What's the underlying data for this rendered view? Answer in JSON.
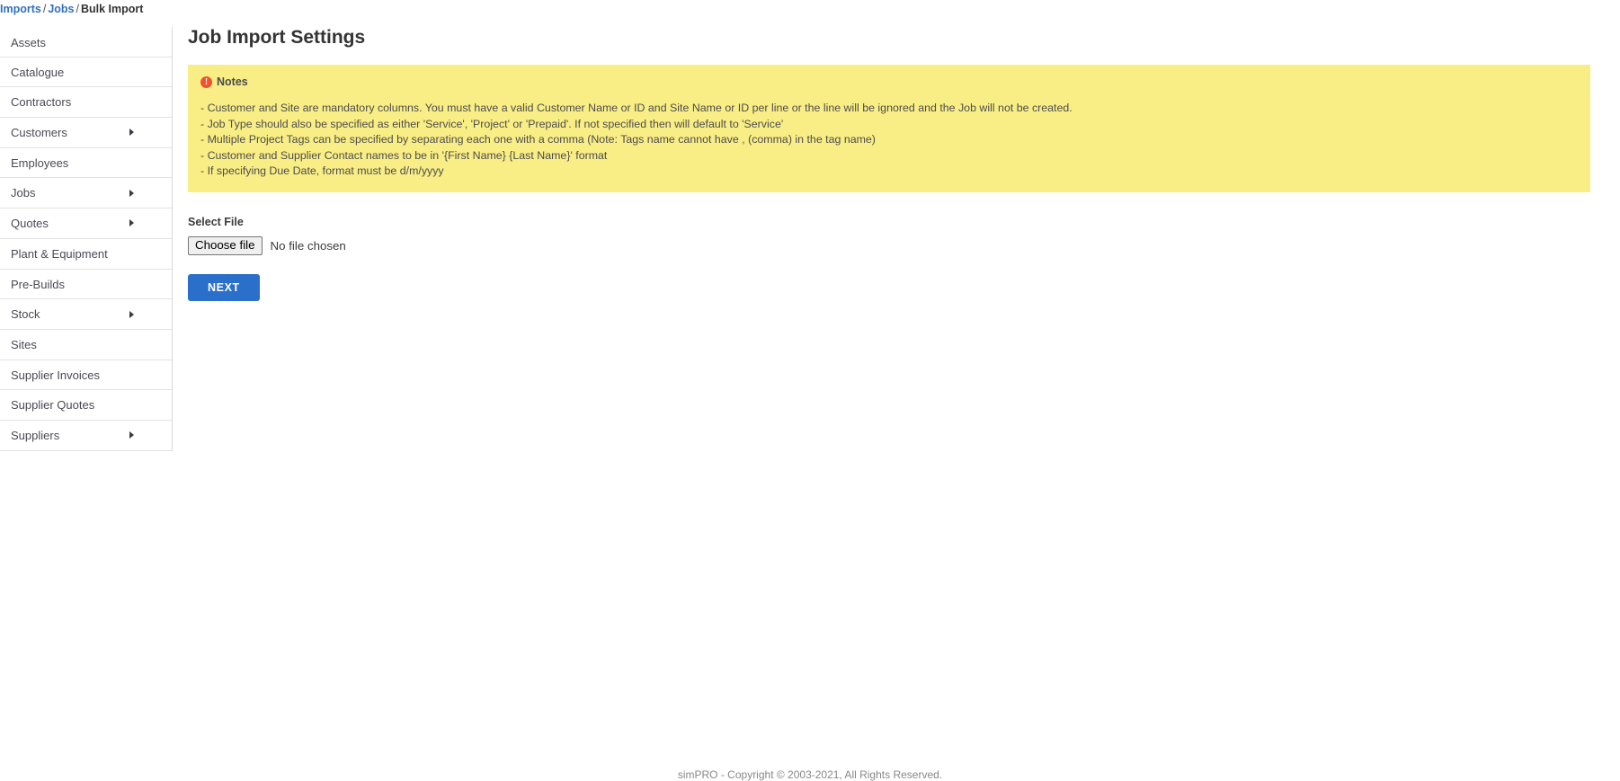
{
  "breadcrumb": {
    "items": [
      {
        "label": "Imports",
        "link": true
      },
      {
        "label": "Jobs",
        "link": true
      },
      {
        "label": "Bulk Import",
        "link": false
      }
    ],
    "separator": "/"
  },
  "sidebar": {
    "items": [
      {
        "label": "Assets",
        "has_submenu": false
      },
      {
        "label": "Catalogue",
        "has_submenu": false
      },
      {
        "label": "Contractors",
        "has_submenu": false
      },
      {
        "label": "Customers",
        "has_submenu": true
      },
      {
        "label": "Employees",
        "has_submenu": false
      },
      {
        "label": "Jobs",
        "has_submenu": true
      },
      {
        "label": "Quotes",
        "has_submenu": true
      },
      {
        "label": "Plant & Equipment",
        "has_submenu": false
      },
      {
        "label": "Pre-Builds",
        "has_submenu": false
      },
      {
        "label": "Stock",
        "has_submenu": true
      },
      {
        "label": "Sites",
        "has_submenu": false
      },
      {
        "label": "Supplier Invoices",
        "has_submenu": false
      },
      {
        "label": "Supplier Quotes",
        "has_submenu": false
      },
      {
        "label": "Suppliers",
        "has_submenu": true
      }
    ]
  },
  "main": {
    "title": "Job Import Settings",
    "notes": {
      "heading": "Notes",
      "icon": "exclamation-circle-icon",
      "icon_color": "#f0522b",
      "background_color": "#f9ed85",
      "lines": [
        "- Customer and Site are mandatory columns. You must have a valid Customer Name or ID and Site Name or ID per line or the line will be ignored and the Job will not be created.",
        "- Job Type should also be specified as either 'Service', 'Project' or 'Prepaid'. If not specified then will default to 'Service'",
        "- Multiple Project Tags can be specified by separating each one with a comma (Note: Tags name cannot have , (comma) in the tag name)",
        "- Customer and Supplier Contact names to be in '{First Name} {Last Name}' format",
        "- If specifying Due Date, format must be d/m/yyyy"
      ]
    },
    "select_file": {
      "label": "Select File",
      "button_label": "Choose file",
      "status_text": "No file chosen"
    },
    "next_button": {
      "label": "NEXT",
      "color": "#2a6fc9"
    }
  },
  "footer": {
    "text": "simPRO - Copyright © 2003-2021, All Rights Reserved."
  }
}
